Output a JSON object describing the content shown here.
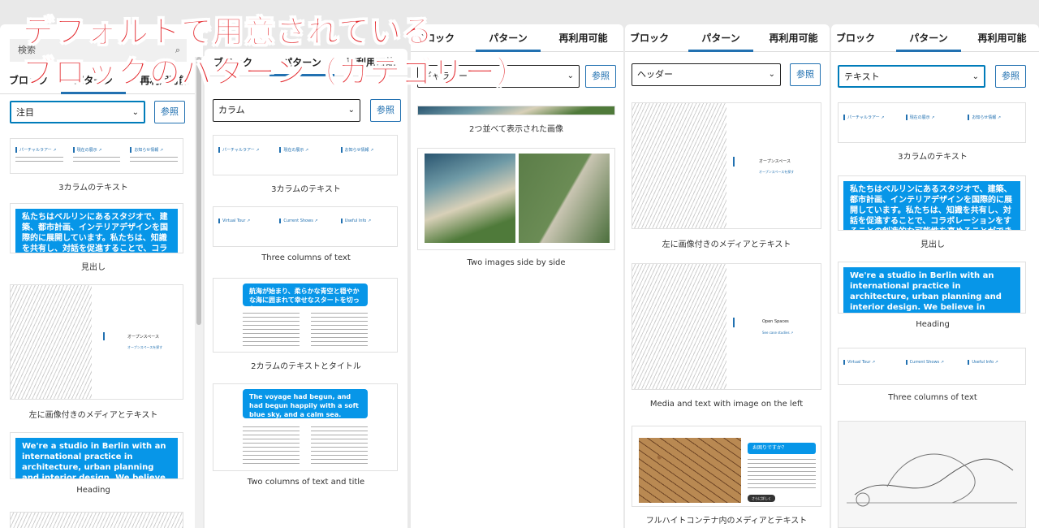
{
  "overlay": {
    "line1": "デフォルトで用意されている",
    "line2": "ブロックのパターン（カテゴリー）"
  },
  "panel1": {
    "search_placeholder": "検索",
    "tabs": [
      "ブロック",
      "パターン",
      "再利用可能"
    ],
    "category": "注目",
    "browse": "参照",
    "captions": [
      "3カラムのテキスト",
      "見出し",
      "左に画像付きのメディアとテキスト",
      "Heading"
    ],
    "heading_jp": "私たちはベルリンにあるスタジオで、建築、都市計画、インテリアデザインを国際的に展開しています。私たちは、知識を共有し、対話を促進することで、コラボレーションをすることの創造的な可能性を高めることができ",
    "heading_en": "We're a studio in Berlin with an international practice in architecture, urban planning and interior design. We believe in sharing knowledge and promoting dialogue to increase the",
    "cols_jp": [
      "パーチャルラアー ↗",
      "現在の展示 ↗",
      "お知らせ情報 ↗"
    ],
    "media_title": "オープンスペース",
    "media_link": "オープンスペースを探す"
  },
  "panel2": {
    "search_placeholder": "検索",
    "tabs": [
      "ブロック",
      "パターン",
      "再利用可能"
    ],
    "category": "カラム",
    "browse": "参照",
    "captions": [
      "3カラムのテキスト",
      "Three columns of text",
      "2カラムのテキストとタイトル",
      "Two columns of text and title"
    ],
    "cols_en": [
      "Virtual Tour ↗",
      "Current Shows ↗",
      "Useful Info ↗"
    ],
    "title_jp": "航海が始まり、柔らかな青空と穏やかな海に囲まれて幸せなスタートを切った。",
    "title_en": "The voyage had begun, and had begun happily with a soft blue sky, and a calm sea."
  },
  "panel3": {
    "tabs": [
      "ブロック",
      "パターン",
      "再利用可能"
    ],
    "category": "ギャラリー",
    "browse": "参照",
    "captions": [
      "2つ並べて表示された画像",
      "Two images side by side"
    ]
  },
  "panel4": {
    "tabs": [
      "ブロック",
      "パターン",
      "再利用可能"
    ],
    "category": "ヘッダー",
    "browse": "参照",
    "captions": [
      "左に画像付きのメディアとテキスト",
      "Media and text with image on the left",
      "フルハイトコンテナ内のメディアとテキスト"
    ],
    "media_title_jp": "オープンスペース",
    "media_title_en": "Open Spaces",
    "media_link_en": "See case studies ↗",
    "callout": "お困りですか？",
    "callout_btn": "さらに詳しく"
  },
  "panel5": {
    "tabs": [
      "ブロック",
      "パターン",
      "再利用可能"
    ],
    "category": "テキスト",
    "browse": "参照",
    "captions": [
      "3カラムのテキスト",
      "見出し",
      "Heading",
      "Three columns of text"
    ],
    "cols_jp": [
      "パーチャルラアー ↗",
      "現在の展示 ↗",
      "お知らせ情報 ↗"
    ],
    "cols_en": [
      "Virtual Tour ↗",
      "Current Shows ↗",
      "Useful Info ↗"
    ]
  }
}
